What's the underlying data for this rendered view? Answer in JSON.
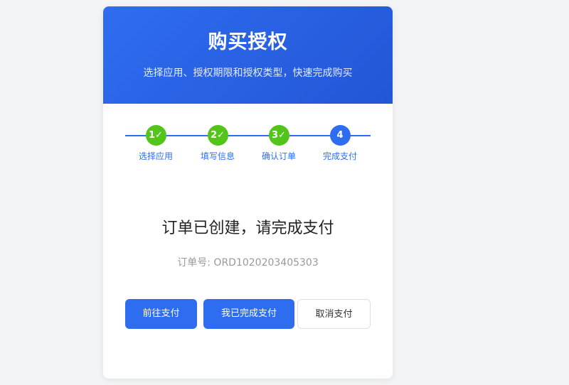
{
  "header": {
    "title": "购买授权",
    "subtitle": "选择应用、授权期限和授权类型，快速完成购买"
  },
  "steps": [
    {
      "marker": "1✓",
      "label": "选择应用",
      "state": "done"
    },
    {
      "marker": "2✓",
      "label": "填写信息",
      "state": "done"
    },
    {
      "marker": "3✓",
      "label": "确认订单",
      "state": "done"
    },
    {
      "marker": "4",
      "label": "完成支付",
      "state": "current"
    }
  ],
  "status": {
    "title": "订单已创建，请完成支付",
    "order_label": "订单号:",
    "order_number": "ORD1020203405303"
  },
  "actions": {
    "pay_label": "前往支付",
    "completed_label": "我已完成支付",
    "cancel_label": "取消支付"
  },
  "colors": {
    "accent": "#2f6df0",
    "success": "#52c41a"
  }
}
